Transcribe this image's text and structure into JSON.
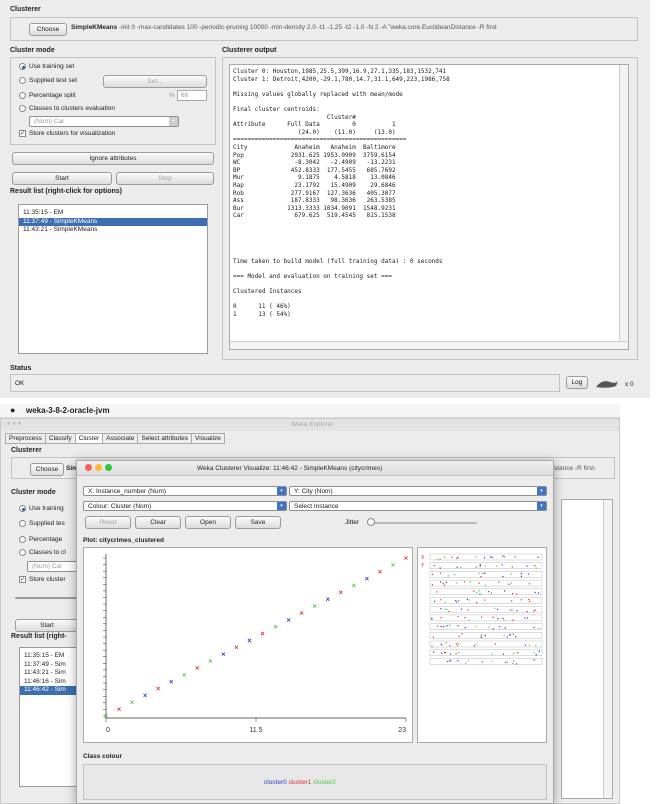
{
  "top": {
    "clusterer_title": "Clusterer",
    "choose_label": "Choose",
    "algo_name": "SimpleKMeans",
    "algo_args": "-init 0 -max-candidates 100 -periodic-pruning 10000 -min-density 2.0 -t1 -1.25 -t2 -1.0 -N 2 -A \"weka.core.EuclideanDistance -R first",
    "cluster_mode_title": "Cluster mode",
    "modes": {
      "use_training": "Use training set",
      "supplied": "Supplied test set",
      "set_btn": "Set...",
      "percentage": "Percentage split",
      "pct_symbol": "%",
      "pct_value": "66",
      "classes": "Classes to clusters evaluation",
      "class_attr": "(Num) Car",
      "store": "Store clusters for visualization"
    },
    "ignore_btn": "Ignore attributes",
    "start_btn": "Start",
    "stop_btn": "Stop",
    "result_title": "Result list (right-click for options)",
    "results": [
      "11:35:15 - EM",
      "11:37:49 - SimpleKMeans",
      "11:43:21 - SimpleKMeans"
    ],
    "output_title": "Clusterer output",
    "output_text": "Cluster 0: Houston,1985,25.5,399,16.9,27.1,335,183,1532,741\nCluster 1: Detroit,4200,-29.1,780,14.7,31.1,649,223,1986,758\n\nMissing values globally replaced with mean/mode\n\nFinal cluster centroids:\n                          Cluster#\nAttribute      Full Data         0          1\n                  (24.0)    (11.0)     (13.0)\n================================================\nCity             Anaheim   Anaheim  Baltimore\nPop             2931.625 1953.0909  3759.6154\nWC               -8.3042   -2.4909   -13.2231\nBP              452.8333  177.5455   685.7692\nMur               9.1875    4.5818    13.0846\nRap              23.1792   15.4909    29.6846\nRob             277.9167  127.3636   405.3077\nAss             187.8333   98.3636   263.5385\nBur            1313.3333 1034.9091  1548.9231\nCar              679.625  519.4545   815.1538\n\n\n\n\n\nTime taken to build model (full training data) : 0 seconds\n\n=== Model and evaluation on training set ===\n\nClustered Instances\n\n0      11 ( 46%)\n1      13 ( 54%)",
    "status_title": "Status",
    "status_text": "OK",
    "log_btn": "Log",
    "x_count": "x 0"
  },
  "bottom": {
    "app_name": "weka-3-8-2-oracle-jvm",
    "explorer_title": "Weka Explorer",
    "tabs": [
      "Preprocess",
      "Classify",
      "Cluster",
      "Associate",
      "Select attributes",
      "Visualize"
    ],
    "clusterer_title": "Clusterer",
    "choose_label": "Choose",
    "algo_partial": "Sim",
    "args_tail": "stance -R first-",
    "cluster_mode_title": "Cluster mode",
    "mode_use": "Use training",
    "mode_supplied": "Supplied tes",
    "mode_pct": "Percentage",
    "mode_classes": "Classes to cl",
    "mode_class_attr": "(Num) Car",
    "mode_store": "Store cluster",
    "start_btn": "Start",
    "result_title": "Result list (right-",
    "results": [
      "11:35:15 - EM",
      "11:37:49 - Sim",
      "11:43:21 - Sim",
      "11:46:16 - Sim",
      "11:46:42 - Sim"
    ],
    "status_title": "Status",
    "status_text": "OK"
  },
  "viz": {
    "title": "Weka Clusterer Visualize: 11:46:42 - SimpleKMeans (citycrimes)",
    "x_select": "X: Instance_number (Num)",
    "y_select": "Y: City (Nom)",
    "colour_select": "Colour: Cluster (Nom)",
    "instance_select": "Select Instance",
    "reset_btn": "Reset",
    "clear_btn": "Clear",
    "open_btn": "Open",
    "save_btn": "Save",
    "jitter_label": "Jitter",
    "plot_title": "Plot: citycrimes_clustered",
    "x_ticks": [
      "0",
      "11.5",
      "23"
    ],
    "class_colour_title": "Class colour",
    "legend": [
      "cluster0",
      "cluster1",
      "cluster2"
    ],
    "legend_colors": [
      "#2f3cc9",
      "#d2352f",
      "#4fc84f"
    ],
    "colors": {
      "cluster0": "#2f3cc9",
      "cluster1": "#d2352f",
      "cluster2": "#4fc84f",
      "selection": "#3d6fb0"
    }
  },
  "chart_data": {
    "type": "scatter",
    "title": "Plot: citycrimes_clustered",
    "xlabel": "Instance_number",
    "ylabel": "City",
    "xlim": [
      0,
      23
    ],
    "x_ticks": [
      "0",
      "11.5",
      "23"
    ],
    "series": [
      {
        "name": "cluster0",
        "points": [
          [
            3,
            3
          ],
          [
            5,
            5
          ],
          [
            9,
            9
          ],
          [
            11,
            11
          ],
          [
            14,
            14
          ],
          [
            17,
            17
          ],
          [
            20,
            20
          ]
        ]
      },
      {
        "name": "cluster1",
        "points": [
          [
            1,
            1
          ],
          [
            4,
            4
          ],
          [
            7,
            7
          ],
          [
            10,
            10
          ],
          [
            12,
            12
          ],
          [
            15,
            15
          ],
          [
            18,
            18
          ],
          [
            21,
            21
          ],
          [
            23,
            23
          ]
        ]
      },
      {
        "name": "cluster2",
        "points": [
          [
            0,
            0
          ],
          [
            2,
            2
          ],
          [
            6,
            6
          ],
          [
            8,
            8
          ],
          [
            13,
            13
          ],
          [
            16,
            16
          ],
          [
            19,
            19
          ],
          [
            22,
            22
          ]
        ]
      }
    ]
  }
}
